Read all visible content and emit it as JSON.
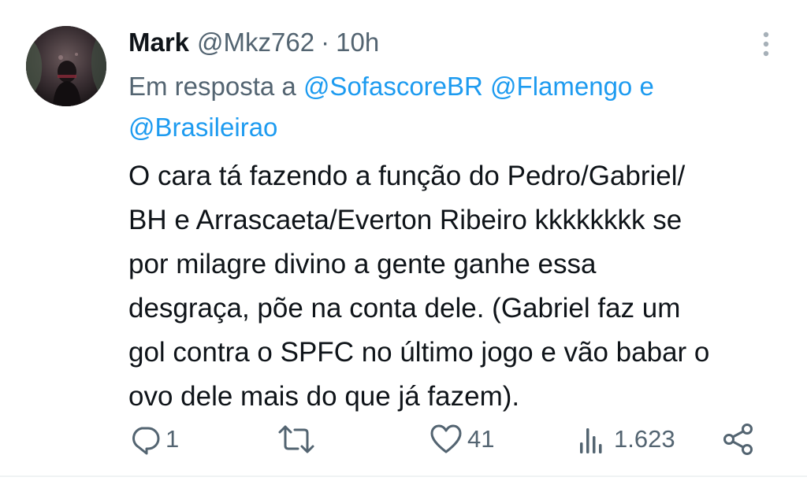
{
  "tweet": {
    "author_name": "Mark",
    "handle": "@Mkz762",
    "separator": "·",
    "time": "10h",
    "reply_prefix": "Em resposta a",
    "mention_1": "@SofascoreBR",
    "mention_2": "@Flamengo",
    "mention_joiner": "e",
    "mention_3": "@Brasileirao",
    "body_lines": [
      "O cara tá fazendo a função do Pedro/Gabriel/",
      "BH e Arrascaeta/Everton Ribeiro kkkkkkkk se",
      "por milagre divino a gente ganhe essa",
      "desgraça, põe na conta dele. (Gabriel faz um",
      "gol contra o SPFC no último jogo e vão babar o",
      "ovo dele mais do que já fazem)."
    ]
  },
  "actions": {
    "reply_icon": "reply-icon",
    "reply_count": "1",
    "retweet_icon": "retweet-icon",
    "retweet_count": "",
    "like_icon": "heart-icon",
    "like_count": "41",
    "views_icon": "views-chart-icon",
    "views_count": "1.623",
    "share_icon": "share-icon"
  },
  "colors": {
    "text": "#0f1419",
    "muted": "#536471",
    "link": "#1d9bf0",
    "background": "#ffffff"
  }
}
